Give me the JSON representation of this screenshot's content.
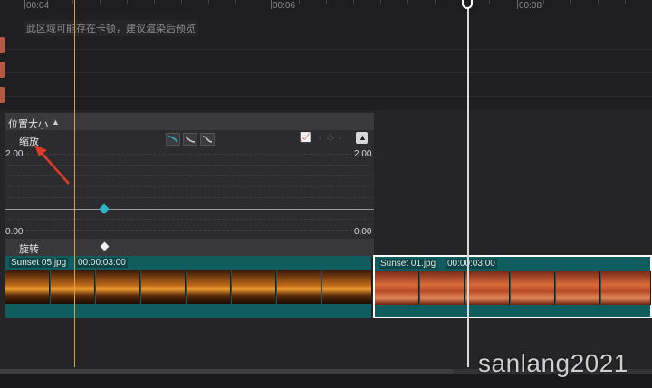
{
  "ruler": {
    "ticks": [
      "00:04",
      "00:06",
      "00:08"
    ]
  },
  "upper": {
    "warning": "此区域可能存在卡顿，建议渲染后预览"
  },
  "panel": {
    "title": "位置大小",
    "property": "缩放",
    "y_max": "2.00",
    "y_min": "0.00",
    "rotate_label": "旋转",
    "icons": [
      "ease-in-icon",
      "ease-out-icon",
      "ease-inout-icon",
      "graph-icon",
      "prev-keyframe-icon",
      "add-keyframe-icon",
      "next-keyframe-icon",
      "collapse-icon"
    ]
  },
  "clips": [
    {
      "name": "Sunset 05.jpg",
      "duration": "00:00:03:00"
    },
    {
      "name": "Sunset 01.jpg",
      "duration": "00:00:03:00"
    }
  ],
  "colors": {
    "clip": "#0f5d5e",
    "keyframe": "#2fb5c8",
    "playhead_marker": "#d9a23a",
    "annotation": "#e03a2a"
  },
  "watermark": "sanlang2021"
}
